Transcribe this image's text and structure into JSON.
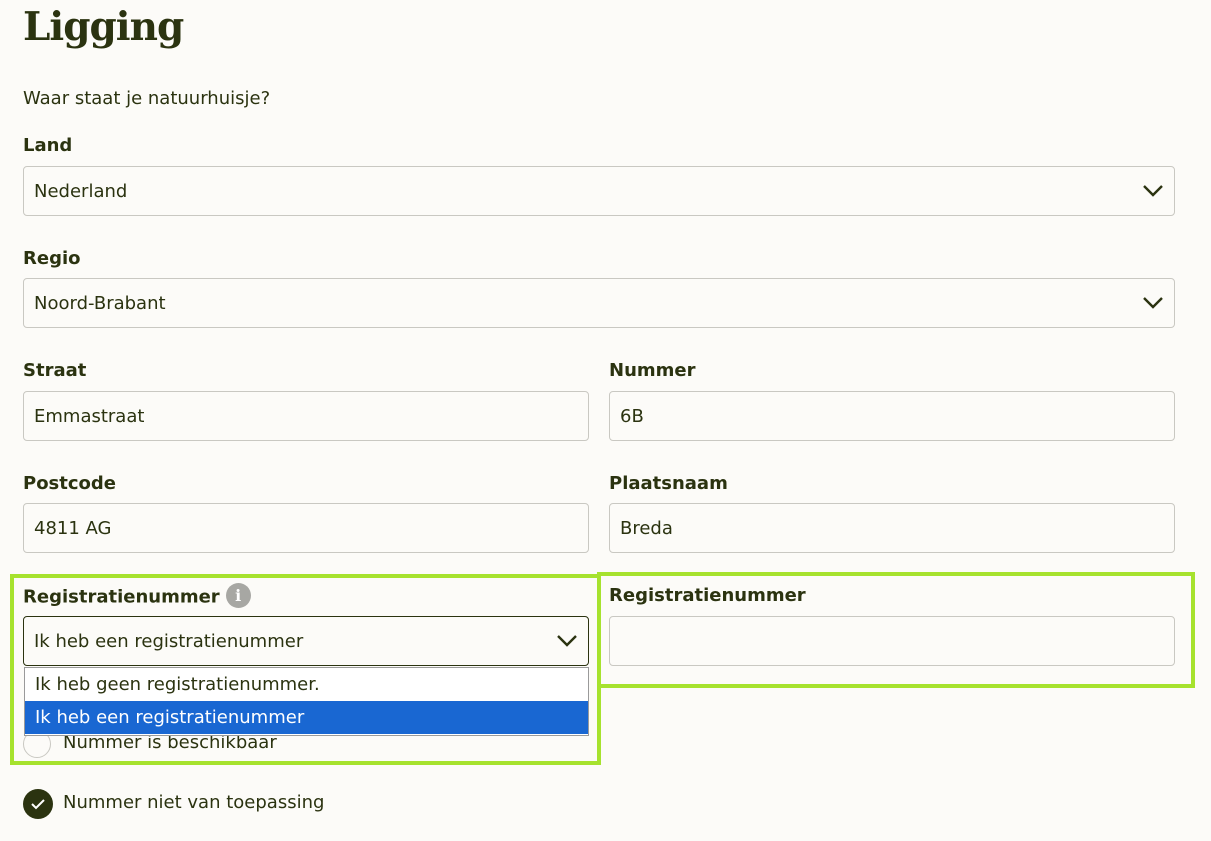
{
  "page": {
    "title": "Ligging",
    "subtitle": "Waar staat je natuurhuisje?"
  },
  "land": {
    "label": "Land",
    "value": "Nederland"
  },
  "regio": {
    "label": "Regio",
    "value": "Noord-Brabant"
  },
  "straat": {
    "label": "Straat",
    "value": "Emmastraat"
  },
  "nummer": {
    "label": "Nummer",
    "value": "6B"
  },
  "postcode": {
    "label": "Postcode",
    "value": "4811 AG"
  },
  "plaatsnaam": {
    "label": "Plaatsnaam",
    "value": "Breda"
  },
  "registratie_select": {
    "label": "Registratienummer",
    "value": "Ik heb een registratienummer",
    "info_icon": "i",
    "options": [
      "Ik heb geen registratienummer.",
      "Ik heb een registratienummer"
    ],
    "selected_index": 1
  },
  "registratie_input": {
    "label": "Registratienummer",
    "value": ""
  },
  "radio_options": {
    "available": "Nummer is beschikbaar",
    "not_applicable": "Nummer niet van toepassing"
  },
  "colors": {
    "text": "#2b3310",
    "highlight": "#a6e22e",
    "dropdown_selected": "#1967d2",
    "info_icon": "#a7a7a3"
  }
}
